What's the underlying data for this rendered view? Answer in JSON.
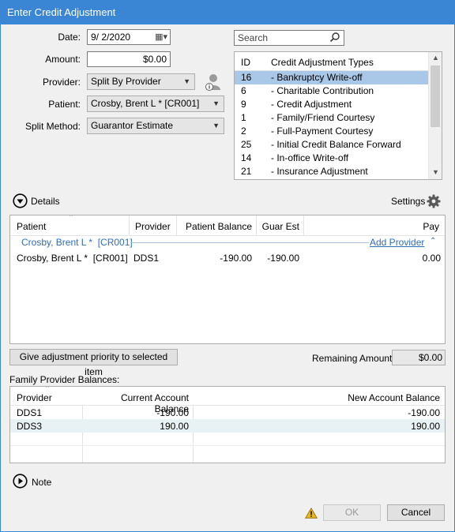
{
  "window": {
    "title": "Enter Credit Adjustment"
  },
  "form": {
    "date_label": "Date:",
    "date_value": "9/ 2/2020",
    "amount_label": "Amount:",
    "amount_value": "$0.00",
    "provider_label": "Provider:",
    "provider_value": "Split By Provider",
    "patient_label": "Patient:",
    "patient_value": "Crosby, Brent L * [CR001]",
    "split_label": "Split Method:",
    "split_value": "Guarantor Estimate"
  },
  "search": {
    "placeholder": "Search"
  },
  "adj_types": {
    "headers": {
      "id": "ID",
      "name": "Credit Adjustment Types"
    },
    "rows": [
      {
        "id": "16",
        "name": "- Bankruptcy Write-off"
      },
      {
        "id": "6",
        "name": "- Charitable Contribution"
      },
      {
        "id": "9",
        "name": "- Credit Adjustment"
      },
      {
        "id": "1",
        "name": "- Family/Friend Courtesy"
      },
      {
        "id": "2",
        "name": "- Full-Payment Courtesy"
      },
      {
        "id": "25",
        "name": "- Initial Credit Balance Forward"
      },
      {
        "id": "14",
        "name": "- In-office Write-off"
      },
      {
        "id": "21",
        "name": "- Insurance Adjustment"
      }
    ],
    "selected_index": 0
  },
  "details": {
    "label": "Details",
    "settings_label": "Settings",
    "headers": {
      "patient": "Patient",
      "provider": "Provider",
      "balance": "Patient Balance",
      "guar": "Guar Est",
      "pay": "Pay"
    },
    "group": {
      "name": "Crosby, Brent L *  [CR001]",
      "add_provider": "Add Provider"
    },
    "rows": [
      {
        "patient": "Crosby, Brent L *  [CR001]",
        "provider": "DDS1",
        "balance": "-190.00",
        "guar": "-190.00",
        "pay": "0.00"
      }
    ]
  },
  "priority_button": "Give adjustment priority to selected item",
  "remaining": {
    "label": "Remaining Amount:",
    "value": "$0.00"
  },
  "family": {
    "label": "Family Provider Balances:",
    "headers": {
      "provider": "Provider",
      "current": "Current Account Balance",
      "new": "New Account Balance"
    },
    "rows": [
      {
        "provider": "DDS1",
        "current": "-190.00",
        "new": "-190.00"
      },
      {
        "provider": "DDS3",
        "current": "190.00",
        "new": "190.00"
      }
    ]
  },
  "note": {
    "label": "Note"
  },
  "buttons": {
    "ok": "OK",
    "cancel": "Cancel"
  },
  "colors": {
    "title_bar": "#3a86d4",
    "selection": "#a9c7e6",
    "link": "#2f6eb5"
  },
  "icons": {
    "calendar": "calendar-icon",
    "search": "search-icon",
    "info": "person-info-icon",
    "settings": "gear-icon",
    "expand": "chevron-down-circle-icon",
    "note": "chevron-right-circle-icon",
    "warning": "warning-icon"
  }
}
